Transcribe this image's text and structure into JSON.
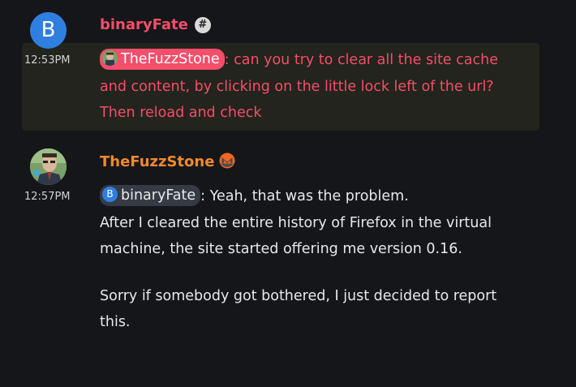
{
  "messages": [
    {
      "author": "binaryFate",
      "avatar_letter": "B",
      "badge_icon": "hash-icon",
      "badge_text": "#",
      "time": "12:53PM",
      "highlighted": true,
      "mention": "TheFuzzStone",
      "text": ": can you try to clear all the site cache and content, by clicking on the little lock left of the url? Then reload and check"
    },
    {
      "author": "TheFuzzStone",
      "badge_icon": "monero-icon",
      "time": "12:57PM",
      "mention": "binaryFate",
      "mention_letter": "B",
      "text": ": Yeah, that was the problem.",
      "lines": [
        "After I cleared the entire history of Firefox in the virtual machine, the site started offering me version 0.16."
      ],
      "paragraph2": "Sorry if somebody got bothered, I just decided to report this."
    }
  ],
  "colors": {
    "background": "#15161a",
    "highlight_bg": "#23241d",
    "mention_red": "#f34e6a",
    "author2": "#f08a2c",
    "avatar_blue": "#2f7fe0",
    "monero_orange": "#f26822"
  }
}
